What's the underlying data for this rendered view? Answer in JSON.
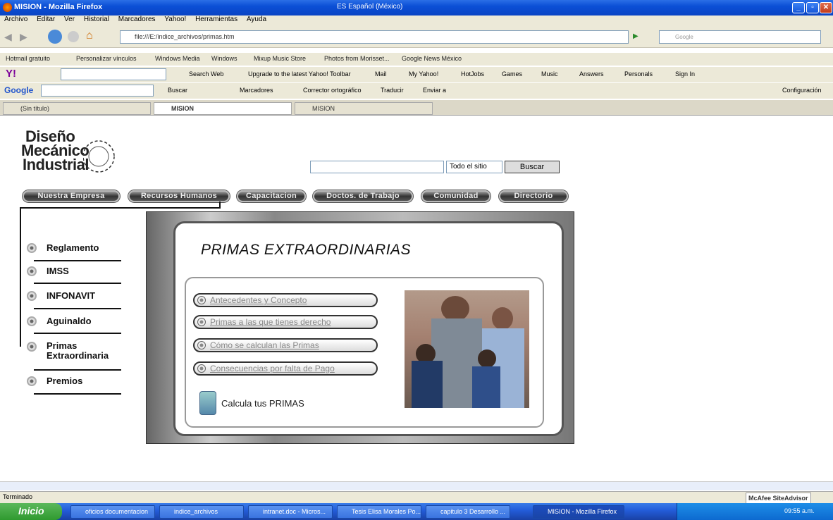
{
  "window": {
    "title": "MISION - Mozilla Firefox",
    "lang": "ES Español (México)"
  },
  "menu": [
    "Archivo",
    "Editar",
    "Ver",
    "Historial",
    "Marcadores",
    "Yahoo!",
    "Herramientas",
    "Ayuda"
  ],
  "nav": {
    "url": "file:///E:/indice_archivos/primas.htm",
    "google_placeholder": "Google"
  },
  "bookmarks": [
    "Hotmail gratuito",
    "Personalizar vínculos",
    "Windows Media",
    "Windows",
    "Mixup Music Store",
    "Photos from Morisset...",
    "Google News México"
  ],
  "yahoo_toolbar": {
    "search": "Search Web",
    "items": [
      "Upgrade to the latest Yahoo! Toolbar",
      "Mail",
      "My Yahoo!",
      "HotJobs",
      "Games",
      "Music",
      "Answers",
      "Personals",
      "Sign In"
    ]
  },
  "google_toolbar": {
    "label": "Google",
    "items": [
      "Buscar",
      "Marcadores",
      "Corrector ortográfico",
      "Traducir",
      "Enviar a"
    ],
    "settings": "Configuración"
  },
  "tabs": [
    "(Sin título)",
    "MISION",
    "MISION"
  ],
  "page": {
    "logo": {
      "line1": "Diseño",
      "line2": "Mecánico",
      "line3": "Industrial"
    },
    "search": {
      "scope": "Todo el sitio",
      "button": "Buscar"
    },
    "topnav": [
      "Nuestra Empresa",
      "Recursos Humanos",
      "Capacitacion",
      "Doctos. de Trabajo",
      "Comunidad",
      "Directorio"
    ],
    "sidebar": [
      "Reglamento",
      "IMSS",
      "INFONAVIT",
      "Aguinaldo",
      "Primas Extraordinaria",
      "Premios"
    ],
    "heading": "PRIMAS EXTRAORDINARIAS",
    "options": [
      "Antecedentes y Concepto",
      "Primas a las que tienes derecho",
      "Cómo se calculan las Primas",
      "Consecuencias por falta de Pago"
    ],
    "calc_label": "Calcula tus PRIMAS"
  },
  "status": {
    "text": "Terminado",
    "mcafee": "McAfee SiteAdvisor"
  },
  "taskbar": {
    "start": "Inicio",
    "items": [
      "oficios documentacion",
      "indice_archivos",
      "intranet.doc - Micros...",
      "Tesis Elisa Morales Po...",
      "capitulo 3 Desarrollo ...",
      "MISION - Mozilla Firefox"
    ],
    "clock": "09:55 a.m."
  }
}
